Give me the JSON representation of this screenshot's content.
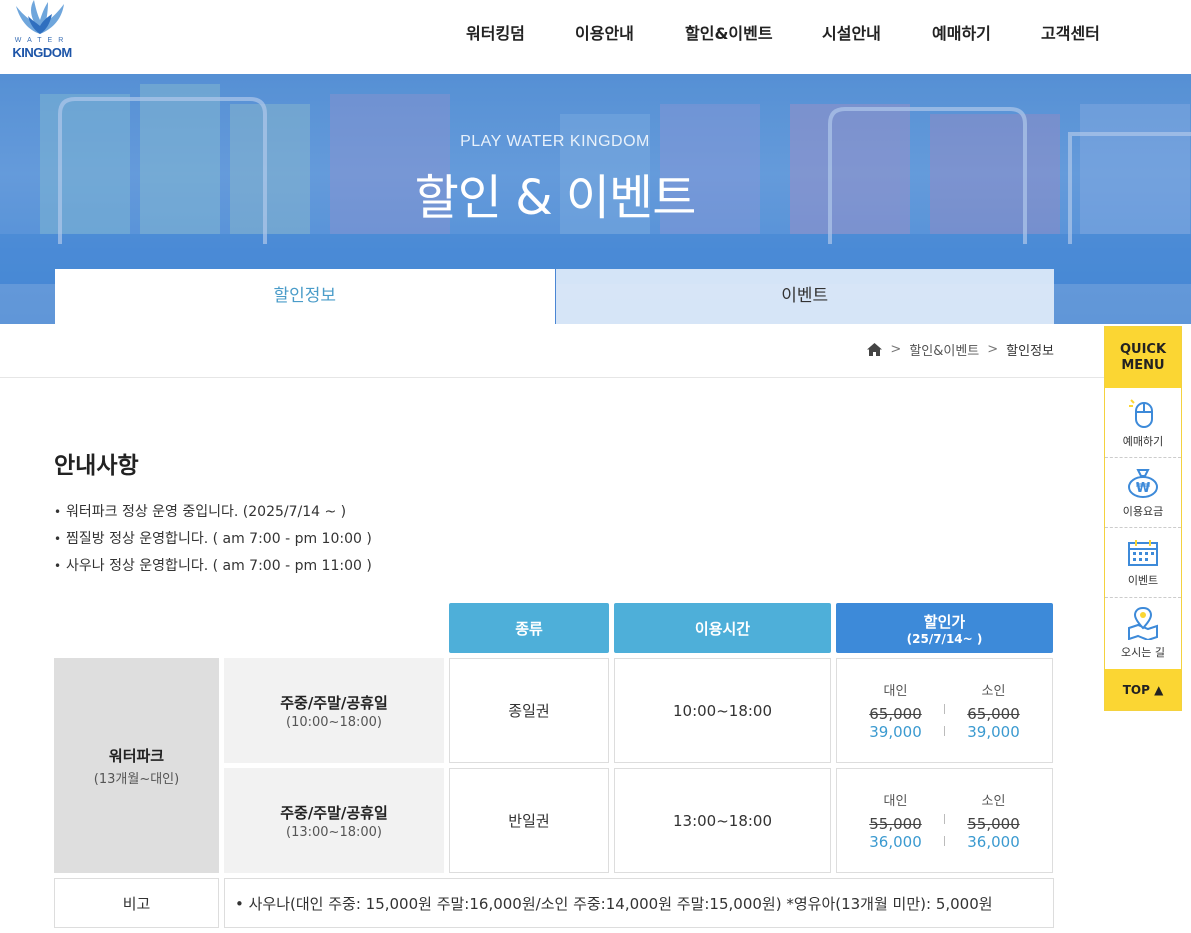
{
  "logo": {
    "line1": "WATER",
    "line2": "KINGDOM"
  },
  "nav": [
    "워터킹덤",
    "이용안내",
    "할인&이벤트",
    "시설안내",
    "예매하기",
    "고객센터"
  ],
  "banner": {
    "subtitle": "PLAY WATER KINGDOM",
    "title": "할인 & 이벤트"
  },
  "tabs": [
    "할인정보",
    "이벤트"
  ],
  "breadcrumb": {
    "level1": "할인&이벤트",
    "level2": "할인정보",
    "separator": ">"
  },
  "notice": {
    "title": "안내사항",
    "items": [
      "워터파크 정상 운영 중입니다. (2025/7/14 ~ )",
      "찜질방 정상 운영합니다. ( am 7:00 - pm 10:00 )",
      "사우나 정상 운영합니다. ( am 7:00 - pm 11:00 )"
    ]
  },
  "table": {
    "headers": {
      "type": "종류",
      "time": "이용시간",
      "price": "할인가",
      "price_sub": "(25/7/14~ )"
    },
    "category": {
      "name": "워터파크",
      "sub": "(13개월~대인)"
    },
    "rows": [
      {
        "day": "주중/주말/공휴일",
        "day_sub": "(10:00~18:00)",
        "type": "종일권",
        "time": "10:00~18:00",
        "adult_label": "대인",
        "child_label": "소인",
        "adult_old": "65,000",
        "adult_new": "39,000",
        "child_old": "65,000",
        "child_new": "39,000"
      },
      {
        "day": "주중/주말/공휴일",
        "day_sub": "(13:00~18:00)",
        "type": "반일권",
        "time": "13:00~18:00",
        "adult_label": "대인",
        "child_label": "소인",
        "adult_old": "55,000",
        "adult_new": "36,000",
        "child_old": "55,000",
        "child_new": "36,000"
      }
    ],
    "note_label": "비고",
    "note_text": "• 사우나(대인 주중: 15,000원 주말:16,000원/소인 주중:14,000원 주말:15,000원) *영유아(13개월 미만): 5,000원"
  },
  "quick_menu": {
    "title_line1": "QUICK",
    "title_line2": "MENU",
    "items": [
      "예매하기",
      "이용요금",
      "이벤트",
      "오시는 길"
    ],
    "top": "TOP ▲"
  },
  "colors": {
    "header_light": "#4eafd9",
    "header_dark": "#3d8ad9",
    "price_new": "#3b9ad0",
    "quick_yellow": "#fbd633"
  }
}
